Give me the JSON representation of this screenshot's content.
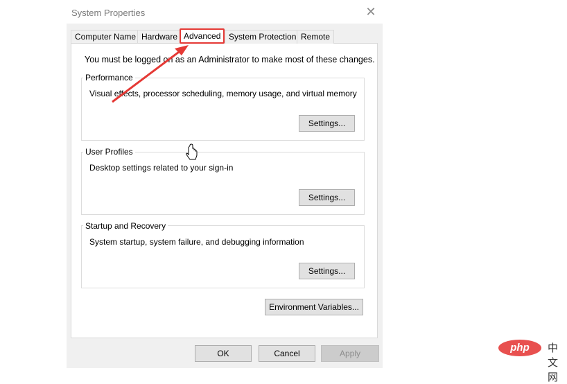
{
  "window": {
    "title": "System Properties",
    "close_icon": "close-icon"
  },
  "tabs": [
    {
      "label": "Computer Name"
    },
    {
      "label": "Hardware"
    },
    {
      "label": "Advanced",
      "active": true
    },
    {
      "label": "System Protection"
    },
    {
      "label": "Remote"
    }
  ],
  "notice": "You must be logged on as an Administrator to make most of these changes.",
  "groups": [
    {
      "label": "Performance",
      "description": "Visual effects, processor scheduling, memory usage, and virtual memory",
      "button": "Settings..."
    },
    {
      "label": "User Profiles",
      "description": "Desktop settings related to your sign-in",
      "button": "Settings..."
    },
    {
      "label": "Startup and Recovery",
      "description": "System startup, system failure, and debugging information",
      "button": "Settings..."
    }
  ],
  "env_button": "Environment Variables...",
  "footer": {
    "ok": "OK",
    "cancel": "Cancel",
    "apply": "Apply"
  },
  "watermark": {
    "logo": "php",
    "text": "中文网"
  },
  "annotation": {
    "highlight_color": "#e53935"
  }
}
